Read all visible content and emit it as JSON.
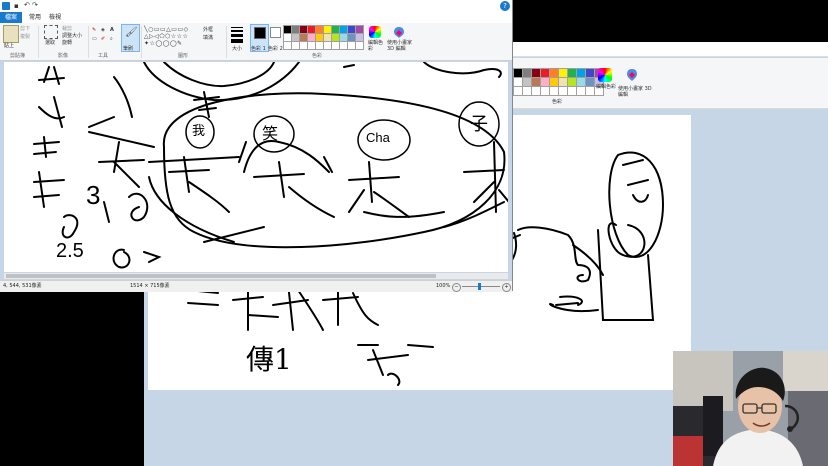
{
  "front": {
    "tabs": [
      "檔案",
      "常用",
      "檢視"
    ],
    "clipboard": {
      "paste": "貼上",
      "cut": "剪下",
      "copy": "複製",
      "label": "剪貼簿"
    },
    "image": {
      "select": "選取",
      "crop": "裁剪",
      "resize": "調整大小",
      "rotate": "旋轉",
      "label": "影像"
    },
    "tools": {
      "label": "工具"
    },
    "brushes": {
      "label": "筆刷"
    },
    "shapes": {
      "outline": "外框",
      "fill": "填滿",
      "label": "圖形"
    },
    "size": {
      "label": "大小"
    },
    "color1": {
      "label": "色彩 1"
    },
    "color2": {
      "label": "色彩 2"
    },
    "colors": {
      "label": "色彩"
    },
    "edit_colors": "編輯色彩",
    "paint3d": "使用小畫家 3D 編輯",
    "status": {
      "cursor": "4, 544, 531像素",
      "dimensions": "1514 × 715像素",
      "zoom": "100%"
    },
    "canvas_text": {
      "me": "我",
      "laugh": "笑",
      "cha": "Cha",
      "zi": "子",
      "amount": "2.5",
      "count": "3"
    }
  },
  "back": {
    "colors_label": "色彩",
    "edit_colors": "編輯色彩",
    "paint3d": "使用小畫家 3D 編輯",
    "canvas_text": {
      "chuan": "傳1"
    }
  },
  "palette": [
    "#000000",
    "#7f7f7f",
    "#880015",
    "#ed1c24",
    "#ff7f27",
    "#fff200",
    "#22b14c",
    "#00a2e8",
    "#3f48cc",
    "#a349a4",
    "#ffffff",
    "#c3c3c3",
    "#b97a57",
    "#ffaec9",
    "#ffc90e",
    "#efe4b0",
    "#b5e61d",
    "#99d9ea",
    "#7092be",
    "#c8bfe7"
  ],
  "accent": "#1979ca"
}
